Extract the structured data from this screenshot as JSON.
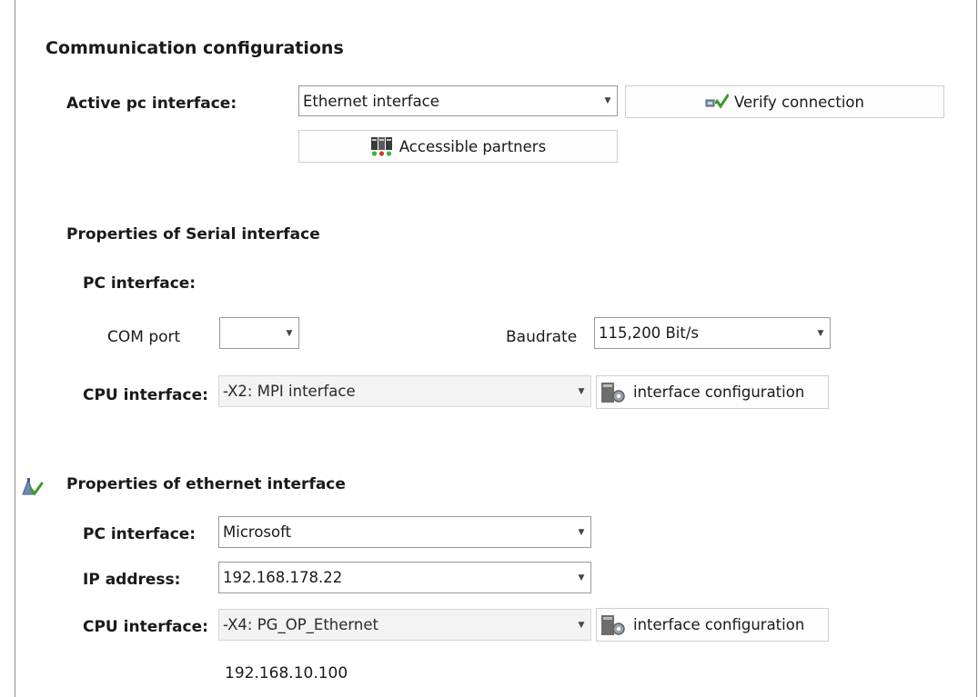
{
  "header": {
    "title": "Communication configurations"
  },
  "active": {
    "label": "Active pc interface:",
    "value": "Ethernet interface",
    "verify_button": "Verify connection",
    "partners_button": "Accessible partners"
  },
  "serial": {
    "title": "Properties of Serial interface",
    "pc_interface_label": "PC interface:",
    "com_port_label": "COM port",
    "com_port_value": "",
    "baudrate_label": "Baudrate",
    "baudrate_value": "115,200 Bit/s",
    "cpu_interface_label": "CPU interface:",
    "cpu_interface_value": "-X2: MPI interface",
    "config_button": "interface configuration"
  },
  "ethernet": {
    "title": "Properties of ethernet interface",
    "pc_interface_label": "PC interface:",
    "pc_interface_value": "Microsoft",
    "ip_label": "IP address:",
    "ip_value": "192.168.178.22",
    "cpu_interface_label": "CPU interface:",
    "cpu_interface_value": "-X4: PG_OP_Ethernet",
    "config_button": "interface configuration",
    "cpu_ip": "192.168.10.100"
  },
  "icons": {
    "verify": "verify-connection-icon",
    "partners": "accessible-partners-icon",
    "config": "interface-configuration-icon",
    "active_marker": "active-interface-icon"
  }
}
